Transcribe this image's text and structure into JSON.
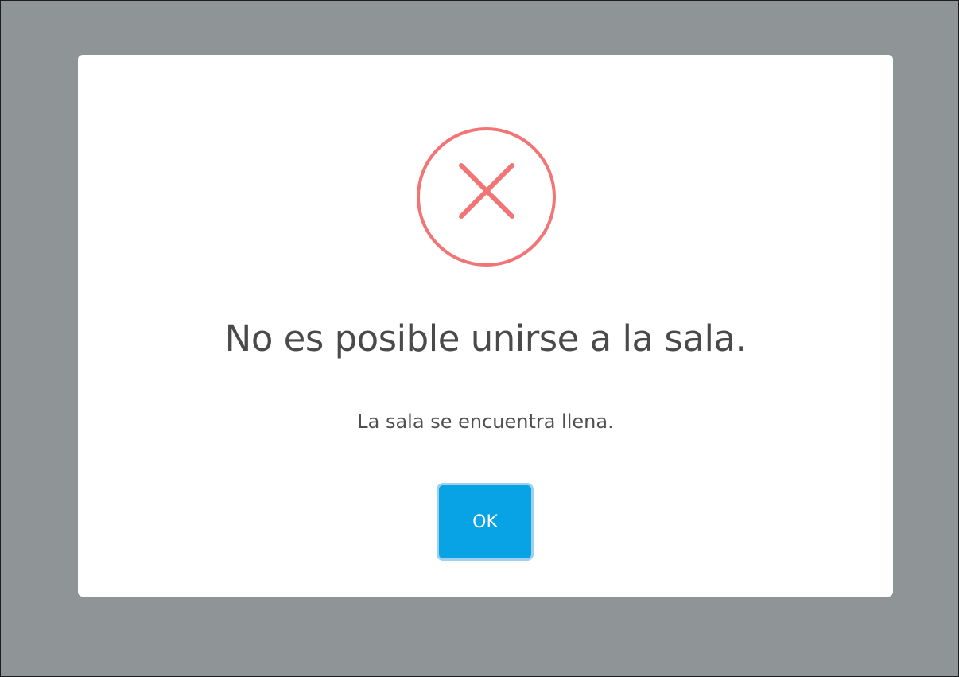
{
  "dialog": {
    "icon": "error-x-icon",
    "title": "No es posible unirse a la sala.",
    "message": "La sala se encuentra llena.",
    "confirm_label": "OK"
  },
  "colors": {
    "backdrop": "#8f9497",
    "dialog_bg": "#ffffff",
    "error": "#f27474",
    "title_text": "#4a4a4a",
    "button_bg": "#08a3e4",
    "button_focus_ring": "#9fd0ee"
  }
}
